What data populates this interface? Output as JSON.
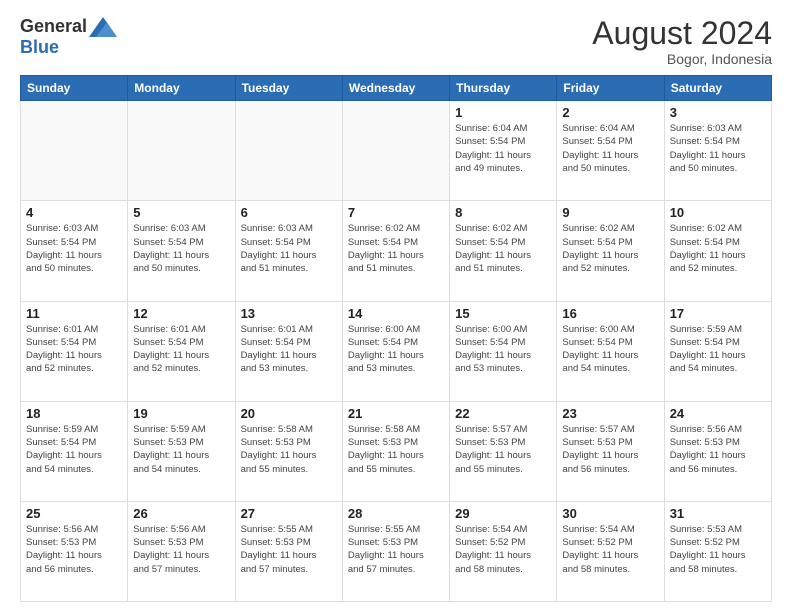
{
  "header": {
    "logo_general": "General",
    "logo_blue": "Blue",
    "month_title": "August 2024",
    "location": "Bogor, Indonesia"
  },
  "days_of_week": [
    "Sunday",
    "Monday",
    "Tuesday",
    "Wednesday",
    "Thursday",
    "Friday",
    "Saturday"
  ],
  "weeks": [
    [
      {
        "day": "",
        "info": ""
      },
      {
        "day": "",
        "info": ""
      },
      {
        "day": "",
        "info": ""
      },
      {
        "day": "",
        "info": ""
      },
      {
        "day": "1",
        "info": "Sunrise: 6:04 AM\nSunset: 5:54 PM\nDaylight: 11 hours\nand 49 minutes."
      },
      {
        "day": "2",
        "info": "Sunrise: 6:04 AM\nSunset: 5:54 PM\nDaylight: 11 hours\nand 50 minutes."
      },
      {
        "day": "3",
        "info": "Sunrise: 6:03 AM\nSunset: 5:54 PM\nDaylight: 11 hours\nand 50 minutes."
      }
    ],
    [
      {
        "day": "4",
        "info": "Sunrise: 6:03 AM\nSunset: 5:54 PM\nDaylight: 11 hours\nand 50 minutes."
      },
      {
        "day": "5",
        "info": "Sunrise: 6:03 AM\nSunset: 5:54 PM\nDaylight: 11 hours\nand 50 minutes."
      },
      {
        "day": "6",
        "info": "Sunrise: 6:03 AM\nSunset: 5:54 PM\nDaylight: 11 hours\nand 51 minutes."
      },
      {
        "day": "7",
        "info": "Sunrise: 6:02 AM\nSunset: 5:54 PM\nDaylight: 11 hours\nand 51 minutes."
      },
      {
        "day": "8",
        "info": "Sunrise: 6:02 AM\nSunset: 5:54 PM\nDaylight: 11 hours\nand 51 minutes."
      },
      {
        "day": "9",
        "info": "Sunrise: 6:02 AM\nSunset: 5:54 PM\nDaylight: 11 hours\nand 52 minutes."
      },
      {
        "day": "10",
        "info": "Sunrise: 6:02 AM\nSunset: 5:54 PM\nDaylight: 11 hours\nand 52 minutes."
      }
    ],
    [
      {
        "day": "11",
        "info": "Sunrise: 6:01 AM\nSunset: 5:54 PM\nDaylight: 11 hours\nand 52 minutes."
      },
      {
        "day": "12",
        "info": "Sunrise: 6:01 AM\nSunset: 5:54 PM\nDaylight: 11 hours\nand 52 minutes."
      },
      {
        "day": "13",
        "info": "Sunrise: 6:01 AM\nSunset: 5:54 PM\nDaylight: 11 hours\nand 53 minutes."
      },
      {
        "day": "14",
        "info": "Sunrise: 6:00 AM\nSunset: 5:54 PM\nDaylight: 11 hours\nand 53 minutes."
      },
      {
        "day": "15",
        "info": "Sunrise: 6:00 AM\nSunset: 5:54 PM\nDaylight: 11 hours\nand 53 minutes."
      },
      {
        "day": "16",
        "info": "Sunrise: 6:00 AM\nSunset: 5:54 PM\nDaylight: 11 hours\nand 54 minutes."
      },
      {
        "day": "17",
        "info": "Sunrise: 5:59 AM\nSunset: 5:54 PM\nDaylight: 11 hours\nand 54 minutes."
      }
    ],
    [
      {
        "day": "18",
        "info": "Sunrise: 5:59 AM\nSunset: 5:54 PM\nDaylight: 11 hours\nand 54 minutes."
      },
      {
        "day": "19",
        "info": "Sunrise: 5:59 AM\nSunset: 5:53 PM\nDaylight: 11 hours\nand 54 minutes."
      },
      {
        "day": "20",
        "info": "Sunrise: 5:58 AM\nSunset: 5:53 PM\nDaylight: 11 hours\nand 55 minutes."
      },
      {
        "day": "21",
        "info": "Sunrise: 5:58 AM\nSunset: 5:53 PM\nDaylight: 11 hours\nand 55 minutes."
      },
      {
        "day": "22",
        "info": "Sunrise: 5:57 AM\nSunset: 5:53 PM\nDaylight: 11 hours\nand 55 minutes."
      },
      {
        "day": "23",
        "info": "Sunrise: 5:57 AM\nSunset: 5:53 PM\nDaylight: 11 hours\nand 56 minutes."
      },
      {
        "day": "24",
        "info": "Sunrise: 5:56 AM\nSunset: 5:53 PM\nDaylight: 11 hours\nand 56 minutes."
      }
    ],
    [
      {
        "day": "25",
        "info": "Sunrise: 5:56 AM\nSunset: 5:53 PM\nDaylight: 11 hours\nand 56 minutes."
      },
      {
        "day": "26",
        "info": "Sunrise: 5:56 AM\nSunset: 5:53 PM\nDaylight: 11 hours\nand 57 minutes."
      },
      {
        "day": "27",
        "info": "Sunrise: 5:55 AM\nSunset: 5:53 PM\nDaylight: 11 hours\nand 57 minutes."
      },
      {
        "day": "28",
        "info": "Sunrise: 5:55 AM\nSunset: 5:53 PM\nDaylight: 11 hours\nand 57 minutes."
      },
      {
        "day": "29",
        "info": "Sunrise: 5:54 AM\nSunset: 5:52 PM\nDaylight: 11 hours\nand 58 minutes."
      },
      {
        "day": "30",
        "info": "Sunrise: 5:54 AM\nSunset: 5:52 PM\nDaylight: 11 hours\nand 58 minutes."
      },
      {
        "day": "31",
        "info": "Sunrise: 5:53 AM\nSunset: 5:52 PM\nDaylight: 11 hours\nand 58 minutes."
      }
    ]
  ]
}
